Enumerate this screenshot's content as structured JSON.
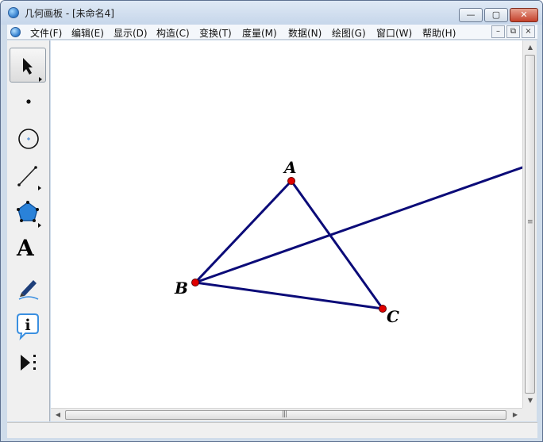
{
  "window": {
    "title": "几何画板 - [未命名4]",
    "controls": {
      "minimize": "—",
      "maximize": "▢",
      "close": "✕"
    }
  },
  "menu": {
    "items": [
      {
        "label": "文件(F)"
      },
      {
        "label": "编辑(E)"
      },
      {
        "label": "显示(D)"
      },
      {
        "label": "构造(C)"
      },
      {
        "label": "变换(T)"
      },
      {
        "label": "度量(M)"
      },
      {
        "label": "数据(N)"
      },
      {
        "label": "绘图(G)"
      },
      {
        "label": "窗口(W)"
      },
      {
        "label": "帮助(H)"
      }
    ],
    "mdi_controls": {
      "minimize": "–",
      "restore": "⧉",
      "close": "×"
    }
  },
  "toolbox": {
    "tools": [
      {
        "name": "arrow-tool",
        "icon": "arrow-select-icon",
        "selected": true
      },
      {
        "name": "point-tool",
        "icon": "point-icon"
      },
      {
        "name": "compass-tool",
        "icon": "circle-icon"
      },
      {
        "name": "straightedge-tool",
        "icon": "segment-icon"
      },
      {
        "name": "polygon-tool",
        "icon": "pentagon-icon"
      },
      {
        "name": "text-tool",
        "icon": "text-A-icon",
        "letter": "A"
      },
      {
        "name": "marker-tool",
        "icon": "marker-pen-icon"
      },
      {
        "name": "information-tool",
        "icon": "info-icon",
        "letter": "i"
      },
      {
        "name": "custom-tool",
        "icon": "custom-tools-icon"
      }
    ]
  },
  "sketch": {
    "points": [
      {
        "label": "A",
        "color": "#e00000"
      },
      {
        "label": "B",
        "color": "#e00000"
      },
      {
        "label": "C",
        "color": "#e00000"
      }
    ],
    "segments": [
      "AB",
      "AC",
      "BC"
    ],
    "rays": [
      "B through right edge"
    ],
    "line_color": "#0b0b78"
  },
  "scrollbars": {
    "grip": "≡"
  }
}
